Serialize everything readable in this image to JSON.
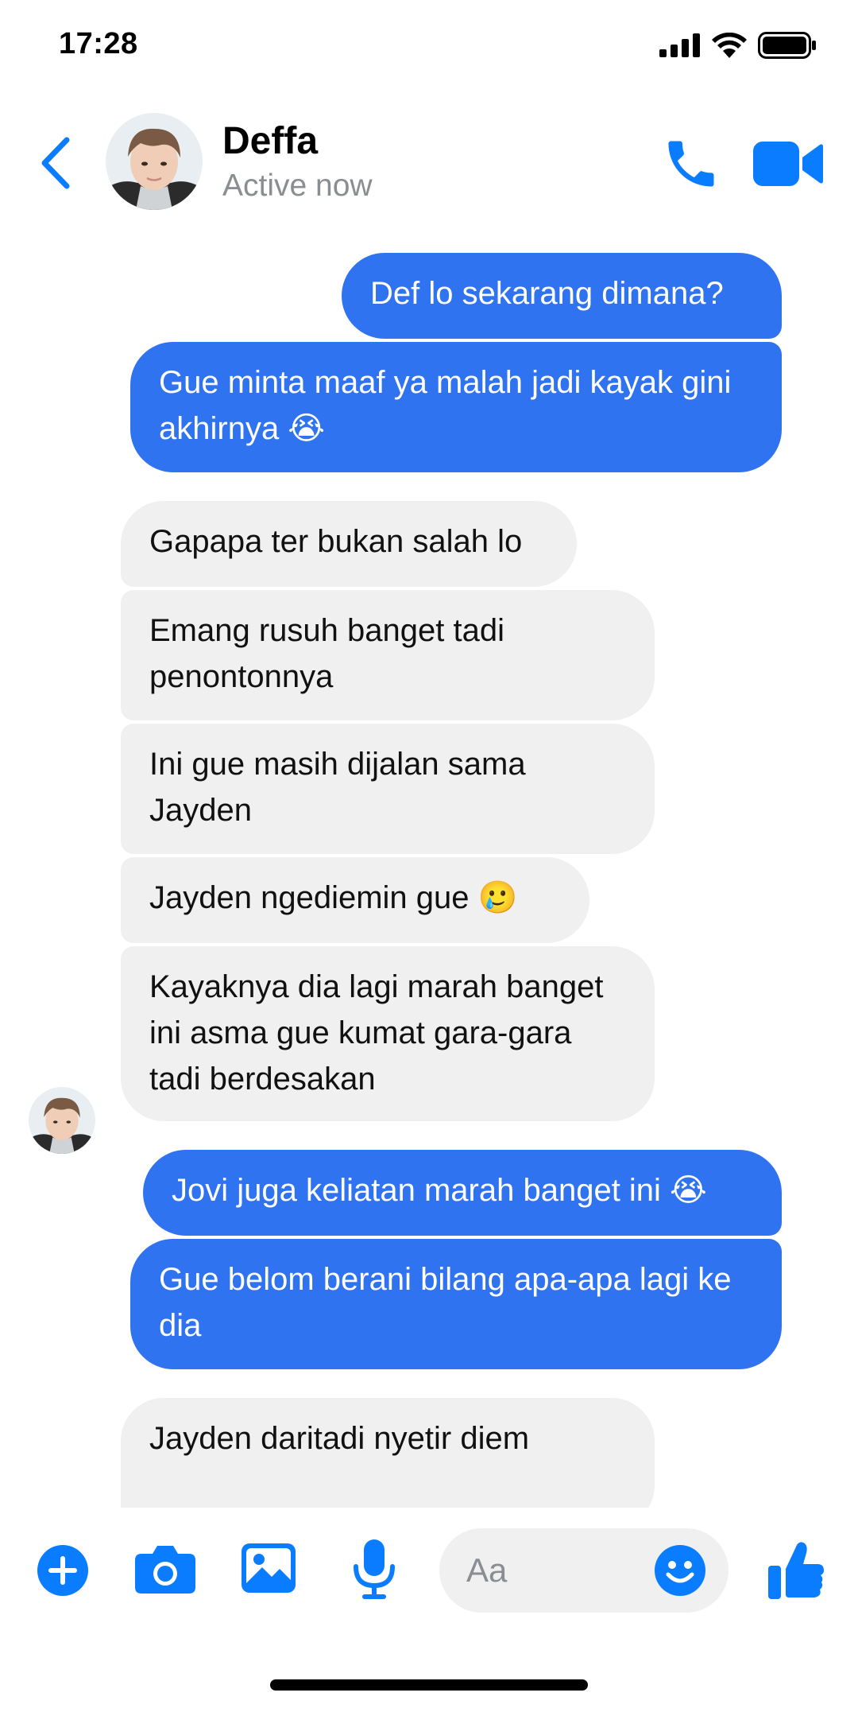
{
  "status_bar": {
    "time": "17:28"
  },
  "header": {
    "contact_name": "Deffa",
    "contact_status": "Active now"
  },
  "messages": [
    {
      "dir": "sent",
      "text": "Def lo sekarang dimana?"
    },
    {
      "dir": "sent",
      "text": "Gue minta maaf ya malah jadi kayak gini akhirnya 😭"
    },
    {
      "dir": "received",
      "text": "Gapapa ter bukan salah lo"
    },
    {
      "dir": "received",
      "text": "Emang rusuh banget tadi penontonnya"
    },
    {
      "dir": "received",
      "text": "Ini gue masih dijalan sama Jayden"
    },
    {
      "dir": "received",
      "text": "Jayden ngediemin gue 🥲"
    },
    {
      "dir": "received",
      "text": "Kayaknya dia lagi marah banget ini asma gue kumat gara-gara tadi berdesakan"
    },
    {
      "dir": "sent",
      "text": "Jovi juga keliatan marah banget ini 😭"
    },
    {
      "dir": "sent",
      "text": "Gue belom berani bilang apa-apa lagi ke dia"
    },
    {
      "dir": "received",
      "text": "Jayden daritadi nyetir diem"
    }
  ],
  "composer": {
    "placeholder": "Aa",
    "value": ""
  },
  "colors": {
    "accent": "#0a7cff",
    "sent_bubble": "#2f73f0",
    "received_bubble": "#f0f0f0",
    "secondary_text": "#8a8d91"
  },
  "icons": [
    "back-chevron-icon",
    "phone-icon",
    "video-camera-icon",
    "plus-icon",
    "camera-icon",
    "image-icon",
    "microphone-icon",
    "emoji-icon",
    "thumbs-up-icon",
    "signal-icon",
    "wifi-icon",
    "battery-icon"
  ]
}
